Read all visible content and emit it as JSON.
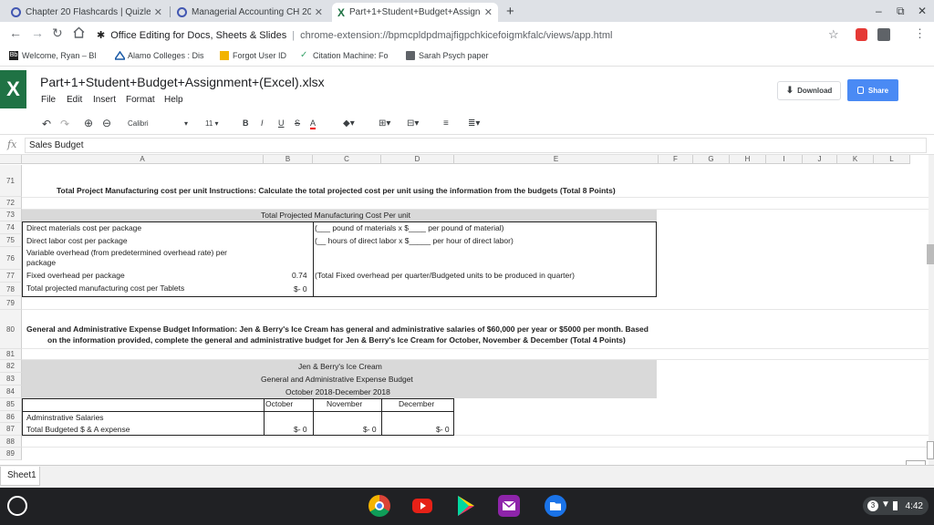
{
  "browser": {
    "tabs": [
      {
        "title": "Chapter 20 Flashcards | Quizlet",
        "active": false,
        "icon": "quizlet-icon"
      },
      {
        "title": "Managerial Accounting CH 20 F",
        "active": false,
        "icon": "quizlet-icon"
      },
      {
        "title": "Part+1+Student+Budget+Assign",
        "active": true,
        "icon": "excel-icon"
      }
    ],
    "new_tab": "+",
    "window_controls": [
      "–",
      "⧉",
      "✕"
    ],
    "url_title": "Office Editing for Docs, Sheets & Slides",
    "url_sep": "|",
    "url": "chrome-extension://bpmcpldpdmajfigpchkicefoigmkfalc/views/app.html",
    "bookmarks": [
      {
        "label": "Welcome, Ryan – Bl",
        "icon": "blackboard-icon"
      },
      {
        "label": "Alamo Colleges : Dis",
        "icon": "alamo-icon"
      },
      {
        "label": "Forgot User ID",
        "icon": "forgot-icon"
      },
      {
        "label": "Citation Machine: Fo",
        "icon": "citation-icon"
      },
      {
        "label": "Sarah Psych paper",
        "icon": "folder-icon"
      }
    ]
  },
  "app": {
    "logo": "X",
    "file_title": "Part+1+Student+Budget+Assignment+(Excel).xlsx",
    "menus": [
      "File",
      "Edit",
      "Insert",
      "Format",
      "Help"
    ],
    "download_label": "Download",
    "share_label": "Share",
    "font_name": "Calibri",
    "font_size": "11",
    "fmt_buttons": [
      "B",
      "I",
      "U",
      "S",
      "A"
    ],
    "formula_prefix": "fx",
    "formula_value": "Sales Budget"
  },
  "grid": {
    "columns": [
      "A",
      "B",
      "C",
      "D",
      "E",
      "F",
      "G",
      "H",
      "I",
      "J",
      "K",
      "L"
    ],
    "rows": [
      "71",
      "72",
      "73",
      "74",
      "75",
      "76",
      "77",
      "78",
      "79",
      "80",
      "81",
      "82",
      "83",
      "84",
      "85",
      "86",
      "87",
      "88",
      "89"
    ],
    "r71_text": "Total Project Manufacturing cost per unit Instructions:  Calculate the total projected cost per unit using the information from the budgets (Total 8 Points)",
    "r73_header": "Total Projected Manufacturing Cost Per unit",
    "r74_label": "Direct materials cost per package",
    "r74_c": "(___ pound of materials x $____  per pound of material)",
    "r75_label": "Direct labor cost per package",
    "r75_c": "(__ hours of direct labor x $_____  per hour of direct labor)",
    "r76_label_1": "Variable overhead (from predetermined overhead rate) per",
    "r76_label_2": "package",
    "r77_label": "Fixed overhead per package",
    "r77_b": "0.74",
    "r77_c": "(Total Fixed overhead per quarter/Budgeted units to be produced in quarter)",
    "r78_label": "Total projected manufacturing cost per Tablets",
    "r78_b": "$-   0",
    "r80_text_1": "General and Administrative Expense Budget Information:  Jen & Berry's Ice Cream has general and administrative salaries of $60,000 per year or $5000 per month.  Based",
    "r80_text_2": "on the information provided, complete the general and administrative budget for Jen & Berry's Ice Cream for October, November & December (Total 4 Points)",
    "r82_title": "Jen & Berry's Ice Cream",
    "r83_title": "General and Administrative Expense Budget",
    "r84_title": "October 2018-December 2018",
    "r85_oct": "October",
    "r85_nov": "November",
    "r85_dec": "December",
    "r86_label": "Adminstrative Salaries",
    "r87_label": "Total Budgeted $ & A expense",
    "r87_b": "$-   0",
    "r87_c": "$-   0",
    "r87_d": "$-   0"
  },
  "sheet_tab": "Sheet1",
  "shelf": {
    "apps": [
      "chrome-icon",
      "youtube-icon",
      "play-store-icon",
      "gmail-icon",
      "files-icon"
    ],
    "tray_badge": "3",
    "time": "4:42"
  },
  "colors": {
    "excel_green": "#1f7244",
    "share_blue": "#4a8af4",
    "shade": "#d9d9d9",
    "shelf": "#202124"
  }
}
